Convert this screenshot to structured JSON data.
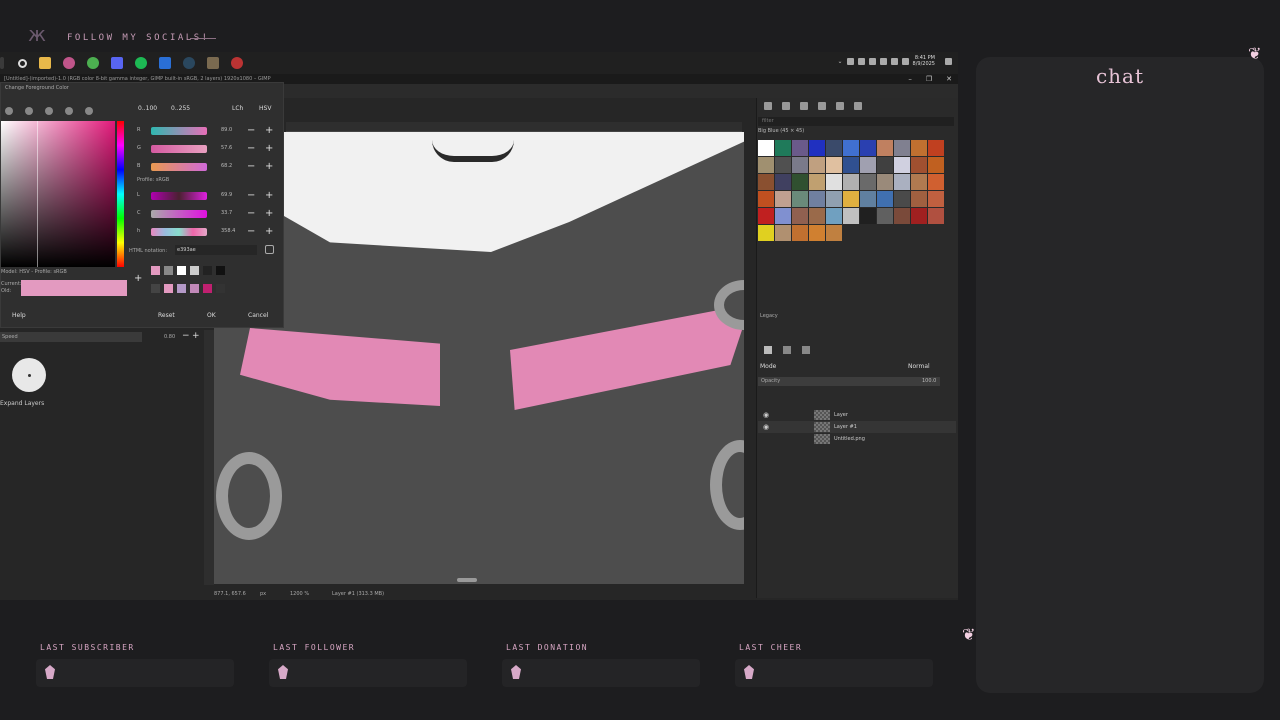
{
  "overlay": {
    "follow_text": "FOLLOW MY SOCIALS!",
    "chat_title": "chat",
    "last_subscriber": "LAST SUBSCRIBER",
    "last_follower": "LAST FOLLOWER",
    "last_donation": "LAST DONATION",
    "last_cheer": "LAST CHEER"
  },
  "taskbar": {
    "clock_time": "8:41 PM",
    "clock_date": "8/9/2025"
  },
  "gimp": {
    "title": "[Untitled]-(imported)-1.0 (RGB color 8-bit gamma integer, GIMP built-in sRGB, 2 layers) 1920x1080 – GIMP",
    "status_coords": "877.1, 657.6",
    "status_unit": "px",
    "status_zoom": "1200 %",
    "status_layer": "Layer #1 (313.3 MB)"
  },
  "color_dialog": {
    "title": "Change Foreground Color",
    "range_a": "0..100",
    "range_b": "0..255",
    "mode_lch": "LCh",
    "mode_hsv": "HSV",
    "r_label": "R",
    "r_value": "89.0",
    "g_label": "G",
    "g_value": "57.6",
    "b_label": "B",
    "b_value": "68.2",
    "profile": "Profile: sRGB",
    "l_label": "L",
    "l_value": "69.9",
    "c_label": "C",
    "c_value": "33.7",
    "h_label": "h",
    "h_value": "358.4",
    "html_label": "HTML notation:",
    "html_value": "e393ae",
    "model_label": "Model: HSV - Profile: sRGB",
    "current_label": "Current:",
    "old_label": "Old:",
    "help": "Help",
    "reset": "Reset",
    "ok": "OK",
    "cancel": "Cancel"
  },
  "tool_options": {
    "speed_label": "Speed",
    "speed_value": "0.80",
    "expand_layers": "Expand Layers"
  },
  "dock": {
    "filter_placeholder": "filter",
    "pattern_name": "Big Blue (45 × 45)",
    "legacy": "Legacy",
    "mode_label": "Mode",
    "mode_value": "Normal",
    "opacity_label": "Opacity",
    "opacity_value": "100.0",
    "layers": [
      {
        "name": "Layer"
      },
      {
        "name": "Layer #1"
      },
      {
        "name": "Untitled.png"
      }
    ]
  },
  "colors": {
    "accent_pink": "#e289b5",
    "label_pink": "#d6a5c2",
    "current_swatch": "#e39ac0"
  }
}
